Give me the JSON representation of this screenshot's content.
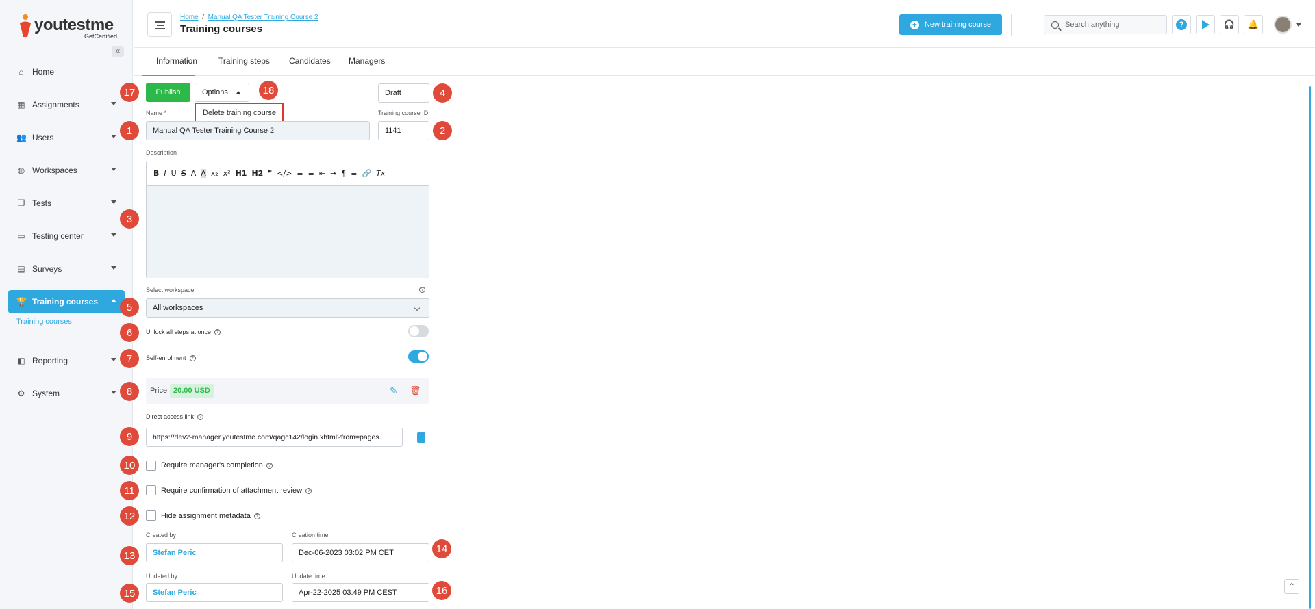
{
  "brand": {
    "name_prefix": "youtest",
    "name_suffix": "me",
    "tagline": "GetCertified"
  },
  "sidebar": {
    "collapse_icon": "«",
    "items": [
      {
        "label": "Home",
        "icon": "home-icon",
        "has_chevron": false
      },
      {
        "label": "Assignments",
        "icon": "grid-icon",
        "has_chevron": true
      },
      {
        "label": "Users",
        "icon": "users-icon",
        "has_chevron": true
      },
      {
        "label": "Workspaces",
        "icon": "globe-icon",
        "has_chevron": true
      },
      {
        "label": "Tests",
        "icon": "tests-icon",
        "has_chevron": true
      },
      {
        "label": "Testing center",
        "icon": "monitor-icon",
        "has_chevron": true
      },
      {
        "label": "Surveys",
        "icon": "survey-icon",
        "has_chevron": true
      },
      {
        "label": "Training courses",
        "icon": "trophy-icon",
        "has_chevron": true,
        "active": true
      },
      {
        "label": "Reporting",
        "icon": "chart-icon",
        "has_chevron": true
      },
      {
        "label": "System",
        "icon": "gear-icon",
        "has_chevron": true
      }
    ],
    "subitem": "Training courses"
  },
  "header": {
    "breadcrumb": {
      "home": "Home",
      "separator": "/",
      "current": "Manual QA Tester Training Course 2"
    },
    "title": "Training courses",
    "new_button": "New training course",
    "search_placeholder": "Search anything"
  },
  "tabs": [
    "Information",
    "Training steps",
    "Candidates",
    "Managers"
  ],
  "form": {
    "publish": "Publish",
    "options": "Options",
    "dropdown_item": "Delete training course",
    "status_value": "Draft",
    "name_label": "Name *",
    "name_value": "Manual QA Tester Training Course 2",
    "id_label": "Training course ID",
    "id_value": "1141",
    "description_label": "Description",
    "toolbar": [
      "B",
      "I",
      "U",
      "S",
      "A",
      "A",
      "x₂",
      "x²",
      "H1",
      "H2",
      "❞",
      "</>",
      "≡",
      "≡",
      "⇤",
      "⇥",
      "¶",
      "≡",
      "🔗",
      "Tx"
    ],
    "workspace_label": "Select workspace",
    "workspace_value": "All workspaces",
    "unlock_label": "Unlock all steps at once",
    "unlock_on": false,
    "self_enrol_label": "Self-enrolment",
    "self_enrol_on": true,
    "price_label": "Price",
    "price_value": "20.00 USD",
    "direct_link_label": "Direct access link",
    "direct_link_value": "https://dev2-manager.youtestme.com/qagc142/login.xhtml?from=pages...",
    "check_manager": "Require manager's completion",
    "check_attachment": "Require confirmation of attachment review",
    "check_metadata": "Hide assignment metadata",
    "created_by_label": "Created by",
    "created_by_value": "Stefan Peric",
    "creation_time_label": "Creation time",
    "creation_time_value": "Dec-06-2023 03:02 PM CET",
    "updated_by_label": "Updated by",
    "updated_by_value": "Stefan Peric",
    "update_time_label": "Update time",
    "update_time_value": "Apr-22-2025 03:49 PM CEST"
  },
  "badges": [
    "1",
    "2",
    "3",
    "4",
    "5",
    "6",
    "7",
    "8",
    "9",
    "10",
    "11",
    "12",
    "13",
    "14",
    "15",
    "16",
    "17",
    "18"
  ],
  "colors": {
    "accent": "#2fa8e0",
    "publish": "#2db84a",
    "badge": "#e04a3a"
  }
}
